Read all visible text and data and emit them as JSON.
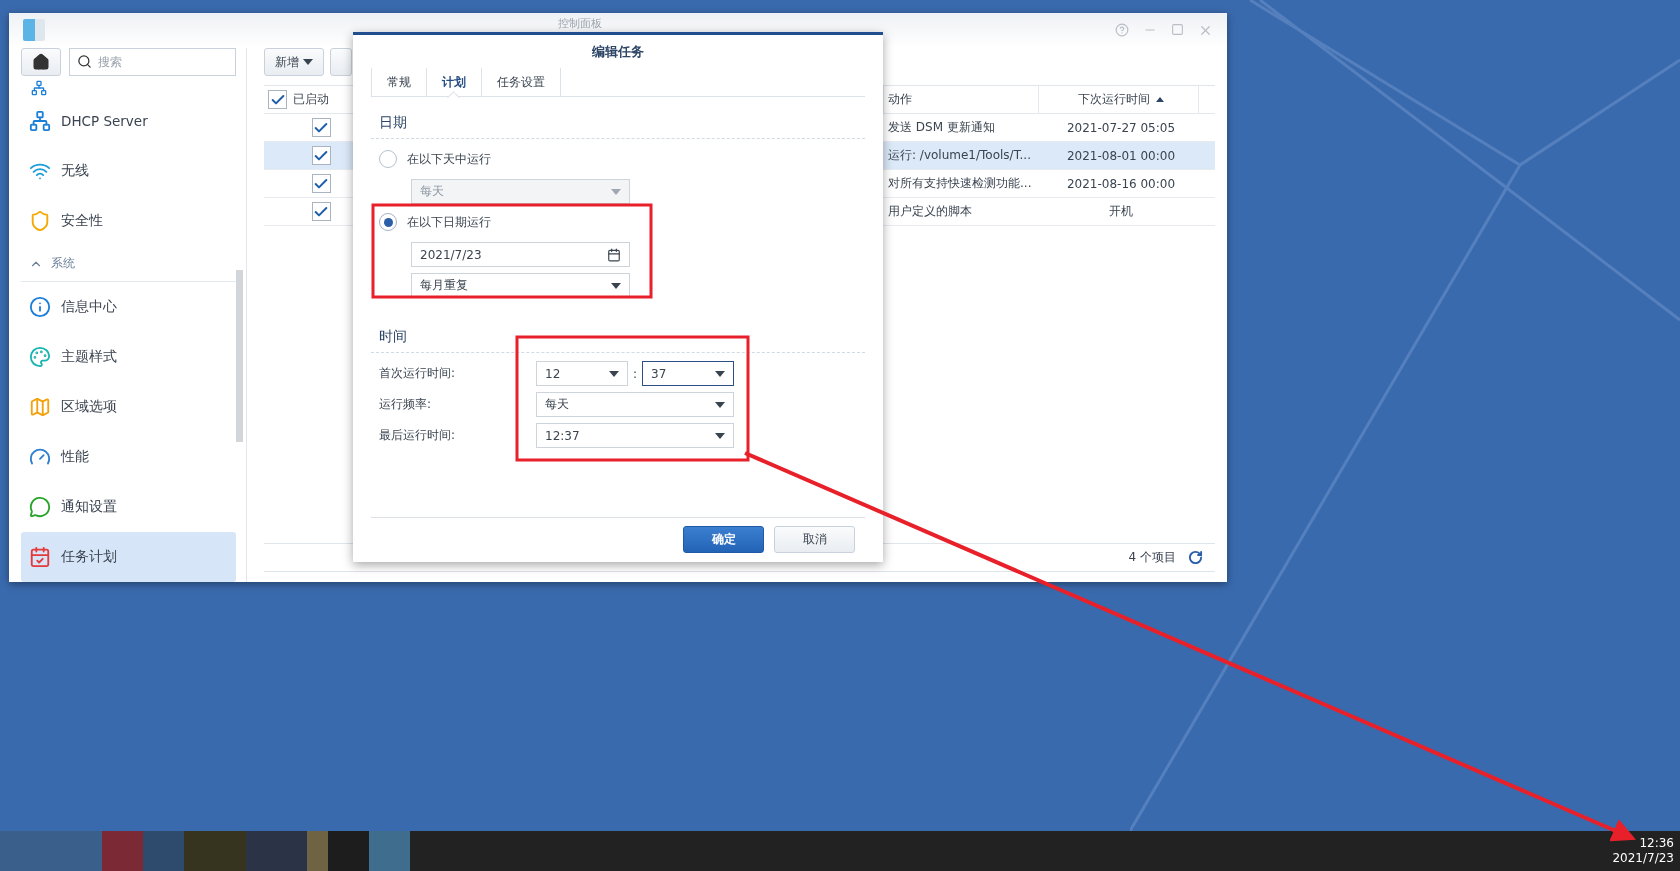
{
  "window": {
    "title": "控制面板"
  },
  "sidebar": {
    "search": {
      "placeholder": "搜索"
    },
    "items": [
      {
        "kind": "item",
        "label": "DHCP Server",
        "selected": false
      },
      {
        "kind": "item",
        "label": "无线",
        "selected": false
      },
      {
        "kind": "item",
        "label": "安全性",
        "selected": false
      },
      {
        "kind": "section",
        "label": "系统",
        "expanded": true
      },
      {
        "kind": "item",
        "label": "信息中心",
        "selected": false
      },
      {
        "kind": "item",
        "label": "主题样式",
        "selected": false
      },
      {
        "kind": "item",
        "label": "区域选项",
        "selected": false
      },
      {
        "kind": "item",
        "label": "性能",
        "selected": false
      },
      {
        "kind": "item",
        "label": "通知设置",
        "selected": false
      },
      {
        "kind": "item",
        "label": "任务计划",
        "selected": true
      }
    ]
  },
  "toolbar": {
    "buttons": [
      "新增"
    ]
  },
  "table": {
    "header_checked": true,
    "columns": [
      {
        "label": "已启动"
      },
      {
        "label": "动作"
      },
      {
        "label": "下次运行时间",
        "sorted": true
      }
    ],
    "rows": [
      {
        "enabled": true,
        "action": "发送 DSM 更新通知",
        "next_run": "2021-07-27 05:05",
        "selected": false
      },
      {
        "enabled": true,
        "action": "运行: /volume1/Tools/T...",
        "next_run": "2021-08-01 00:00",
        "selected": true
      },
      {
        "enabled": true,
        "action": "对所有支持快速检测功能...",
        "next_run": "2021-08-16 00:00",
        "selected": false
      },
      {
        "enabled": true,
        "action": "用户定义的脚本",
        "next_run": "开机",
        "selected": false
      }
    ]
  },
  "footer": {
    "count": "4 个项目"
  },
  "dialog": {
    "title": "编辑任务",
    "tabs": [
      {
        "label": "常规",
        "selected": false
      },
      {
        "label": "计划",
        "selected": true
      },
      {
        "label": "任务设置",
        "selected": false
      }
    ],
    "date": {
      "heading": "日期",
      "options": [
        {
          "label": "在以下天中运行",
          "selected": false,
          "fields": [
            {
              "kind": "select",
              "value": "每天",
              "disabled": true
            }
          ]
        },
        {
          "label": "在以下日期运行",
          "selected": true,
          "fields": [
            {
              "kind": "date",
              "value": "2021/7/23",
              "disabled": false
            },
            {
              "kind": "select",
              "value": "每月重复",
              "disabled": false
            }
          ]
        }
      ]
    },
    "time": {
      "heading": "时间",
      "first_run": {
        "label": "首次运行时间:",
        "hour": "12",
        "separator": ":",
        "minute": "37"
      },
      "rows": [
        {
          "label": "运行频率:",
          "value": "每天"
        },
        {
          "label": "最后运行时间:",
          "value": "12:37"
        }
      ]
    },
    "buttons": [
      {
        "label": "确定",
        "kind": "primary"
      },
      {
        "label": "取消",
        "kind": "secondary"
      }
    ]
  },
  "taskbar": {
    "time": "12:36",
    "date": "2021/7/23"
  }
}
